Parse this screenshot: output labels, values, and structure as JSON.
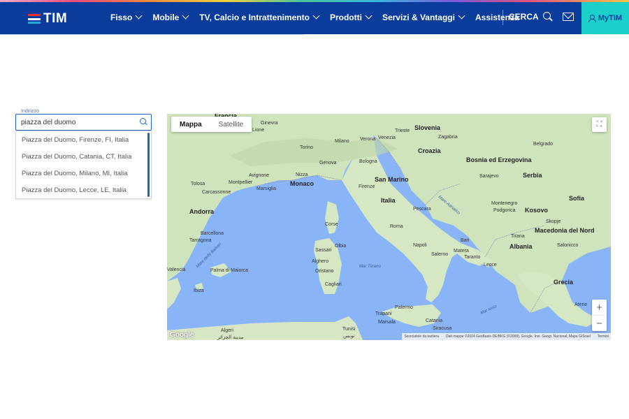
{
  "header": {
    "logo_text": "TIM",
    "brand_color": "#0a3c9c",
    "accent_color": "#1bd0c8",
    "nav": [
      {
        "label": "Fisso",
        "has_chevron": true
      },
      {
        "label": "Mobile",
        "has_chevron": true
      },
      {
        "label": "TV, Calcio e Intrattenimento",
        "has_chevron": true
      },
      {
        "label": "Prodotti",
        "has_chevron": true
      },
      {
        "label": "Servizi & Vantaggi",
        "has_chevron": true
      },
      {
        "label": "Assistenza",
        "has_chevron": false
      }
    ],
    "search_label": "CERCA",
    "mail_icon": "mail-icon",
    "account_label": "MyTIM"
  },
  "address": {
    "legend": "Indirizzo",
    "value": "piazza del duomo",
    "suggestions": [
      "Piazza del Duomo, Firenze, FI, Italia",
      "Piazza del Duomo, Catania, CT, Italia",
      "Piazza del Duomo, Milano, MI, Italia",
      "Piazza del Duomo, Lecce, LE, Italia"
    ]
  },
  "map": {
    "type_buttons": [
      "Mappa",
      "Satellite"
    ],
    "active_type": "Mappa",
    "fullscreen_icon": "fullscreen-icon",
    "zoom_in": "+",
    "zoom_out": "−",
    "google": "Google",
    "footer": {
      "shortcuts": "Scorciatoie da tastiera",
      "data": "Dati mappe ©2024 GeoBasis-DE/BKG (©2009), Google, Inst. Geogr. Nacional, Mapa GISrael",
      "terms": "Termini"
    },
    "labels": {
      "francia": "Francia",
      "lione": "Lione",
      "ginevra": "Ginevra",
      "milano": "Milano",
      "torino": "Torino",
      "verona": "Verona",
      "venezia": "Venezia",
      "trieste": "Trieste",
      "slovenia": "Slovenia",
      "zagabria": "Zagabria",
      "croazia": "Croazia",
      "genova": "Genova",
      "bologna": "Bologna",
      "monaco": "Monaco",
      "nizza": "Nizza",
      "firenze": "Firenze",
      "san_marino": "San Marino",
      "italia": "Italia",
      "pescara": "Pescara",
      "roma": "Roma",
      "bosnia": "Bosnia ed Erzegovina",
      "sarajevo": "Sarajevo",
      "serbia": "Serbia",
      "belgrado": "Belgrado",
      "montenegro": "Montenegro",
      "podgorica": "Podgorica",
      "kosovo": "Kosovo",
      "sofia": "Sofia",
      "macedonia": "Macedonia del Nord",
      "skopje": "Skopje",
      "tirana": "Tirana",
      "albania": "Albania",
      "salonicco": "Salonicco",
      "grecia": "Grecia",
      "atene": "Atene",
      "bari": "Bari",
      "napoli": "Napoli",
      "salerno": "Salerno",
      "matera": "Matera",
      "taranto": "Taranto",
      "lecce": "Lecce",
      "tolosa": "Tolosa",
      "montpellier": "Montpellier",
      "marsiglia": "Marsiglia",
      "avignone": "Avignone",
      "carcassonne": "Carcassonne",
      "andorra": "Andorra",
      "barcellona": "Barcellona",
      "tarragona": "Tarragona",
      "valencia": "Valencia",
      "palma": "Palma di Maiorca",
      "ibiza": "Ibiza",
      "corse": "Corse",
      "sassari": "Sassari",
      "olbia": "Olbia",
      "alghero": "Alghero",
      "oristano": "Oristano",
      "cagliari": "Cagliari",
      "palermo": "Palermo",
      "trapani": "Trapani",
      "marsala": "Marsala",
      "catania": "Catania",
      "siracusa": "Siracusa",
      "algeri": "Algeri",
      "algeri_ar": "مدينة الجزائر",
      "tunisi": "Tunisi",
      "tunisi_ar": "تونس",
      "sea_tirreno": "Mar Tirreno",
      "sea_adriatico": "Mare Adriatico",
      "sea_ionio": "Mar Ionio",
      "sea_baleari": "Mare delle Baleari"
    }
  }
}
